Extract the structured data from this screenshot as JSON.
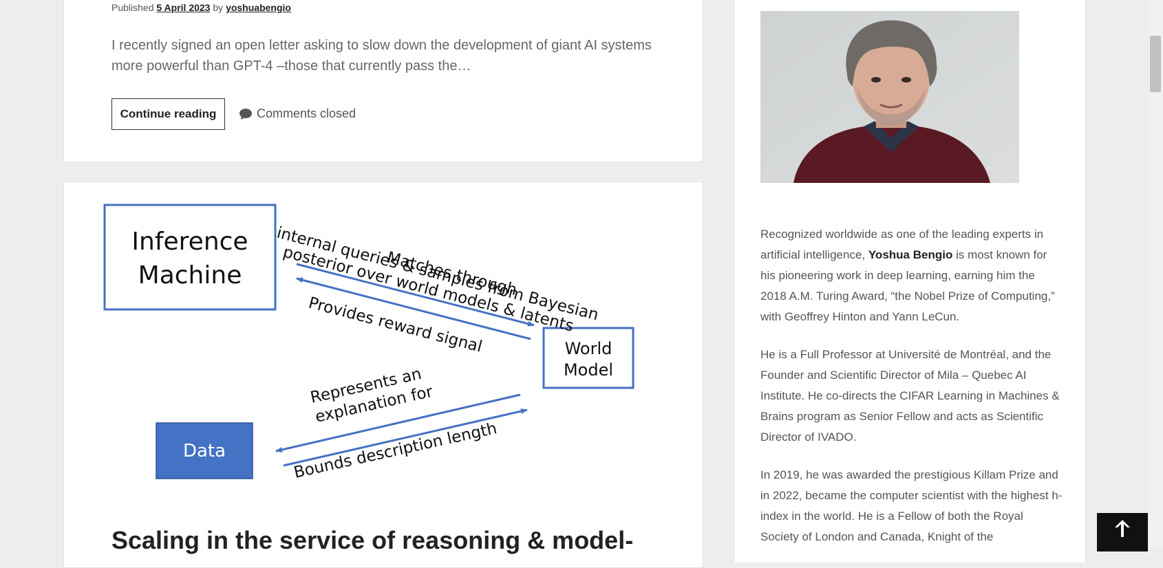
{
  "post1": {
    "published_prefix": "Published",
    "date": "5 April 2023",
    "by": "by",
    "author": "yoshuabengio",
    "excerpt": "I recently signed an open letter asking to slow down the development of giant AI systems more powerful than GPT-4  –those that currently pass the…",
    "continue_label": "Continue reading",
    "comments_label": "Comments closed"
  },
  "diagram": {
    "inference_line1": "Inference",
    "inference_line2": "Machine",
    "world_line1": "World",
    "world_line2": "Model",
    "data": "Data",
    "matches_line1": "Matches through",
    "matches_line2": "internal queries & samples from Bayesian",
    "matches_line3": "posterior over world models & latents",
    "reward": "Provides reward signal",
    "represents_line1": "Represents an",
    "represents_line2": "explanation for",
    "bounds": "Bounds description length",
    "colors": {
      "box_border": "#4472c4",
      "arrow": "#4472c4",
      "data_fill": "#4472c4"
    }
  },
  "post2": {
    "title": "Scaling in the service of reasoning & model-"
  },
  "sidebar": {
    "bio_p1_a": "Recognized worldwide as one of the leading experts in artificial intelligence, ",
    "bio_p1_name": "Yoshua Bengio",
    "bio_p1_b": " is most known for his pioneering work in deep learning, earning him the 2018 A.M. Turing Award, “the Nobel Prize of Computing,” with Geoffrey Hinton and Yann LeCun.",
    "bio_p2": "He is a Full Professor at Université de Montréal, and the Founder and Scientific Director of Mila – Quebec AI Institute. He co-directs the CIFAR Learning in Machines & Brains program as Senior Fellow and acts as Scientific Director of IVADO.",
    "bio_p3": "In 2019, he was awarded the prestigious Killam Prize and in 2022, became the computer scientist with the highest h-index in the world. He is a Fellow of both the Royal Society of London and Canada, Knight of the"
  },
  "icons": {
    "comment": "comment-bubble-icon",
    "back_to_top": "arrow-up-icon"
  }
}
